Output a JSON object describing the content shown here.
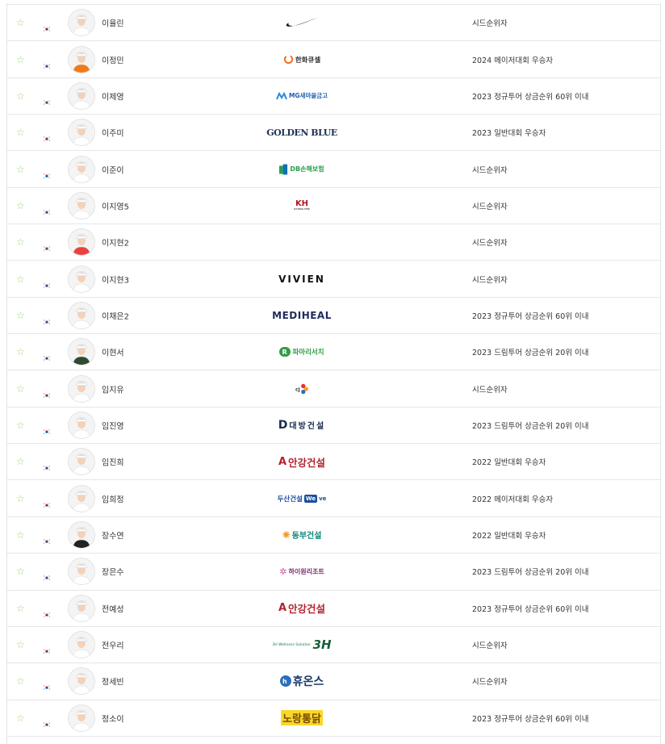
{
  "players": [
    {
      "name": "이율린",
      "sponsor_logo": "nike-logo",
      "sponsor": "",
      "qualification": "시드순위자",
      "shirt": "#ffffff"
    },
    {
      "name": "이정민",
      "sponsor_logo": "hanwha-life-logo",
      "sponsor": "한화큐셀",
      "qualification": "2024 메이저대회 우승자",
      "shirt": "#f07a1a"
    },
    {
      "name": "이제영",
      "sponsor_logo": "mg-saemaul-logo",
      "sponsor": "MG새마을금고",
      "qualification": "2023 정규투어 상금순위 60위 이내",
      "shirt": "#ffffff"
    },
    {
      "name": "이주미",
      "sponsor_logo": "golden-blue-logo",
      "sponsor": "GOLDEN BLUE",
      "qualification": "2023 일반대회 우승자",
      "shirt": "#ffffff"
    },
    {
      "name": "이준이",
      "sponsor_logo": "db-insurance-logo",
      "sponsor": "DB손해보험",
      "qualification": "시드순위자",
      "shirt": "#ffffff"
    },
    {
      "name": "이지영5",
      "sponsor_logo": "kyung-hee-logo",
      "sponsor": "KH",
      "qualification": "시드순위자",
      "shirt": "#ffffff"
    },
    {
      "name": "이지현2",
      "sponsor_logo": "",
      "sponsor": "",
      "qualification": "시드순위자",
      "shirt": "#e8433f"
    },
    {
      "name": "이지현3",
      "sponsor_logo": "vivien-logo",
      "sponsor": "VIVIEN",
      "qualification": "시드순위자",
      "shirt": "#ffffff"
    },
    {
      "name": "이채은2",
      "sponsor_logo": "mediheal-logo",
      "sponsor": "MEDIHEAL",
      "qualification": "2023 정규투어 상금순위 60위 이내",
      "shirt": "#ffffff"
    },
    {
      "name": "이현서",
      "sponsor_logo": "pamarisearch-logo",
      "sponsor": "파마리서치",
      "qualification": "2023 드림투어 상금순위 20위 이내",
      "shirt": "#2e4a33"
    },
    {
      "name": "임지유",
      "sponsor_logo": "cj-logo",
      "sponsor": "",
      "qualification": "시드순위자",
      "shirt": "#ffffff"
    },
    {
      "name": "임진영",
      "sponsor_logo": "daebang-logo",
      "sponsor": "대방건설",
      "qualification": "2023 드림투어 상금순위 20위 이내",
      "shirt": "#ffffff"
    },
    {
      "name": "임진희",
      "sponsor_logo": "ahn-gang-logo",
      "sponsor": "안강건설",
      "qualification": "2022 일반대회 우승자",
      "shirt": "#ffffff"
    },
    {
      "name": "임희정",
      "sponsor_logo": "doosan-we-logo",
      "sponsor": "두산건설",
      "qualification": "2022 메이저대회 우승자",
      "shirt": "#ffffff"
    },
    {
      "name": "장수연",
      "sponsor_logo": "dongbu-logo",
      "sponsor": "동부건설",
      "qualification": "2022 일반대회 우승자",
      "shirt": "#222222"
    },
    {
      "name": "장은수",
      "sponsor_logo": "high1-logo",
      "sponsor": "하이원리조트",
      "qualification": "2023 드림투어 상금순위 20위 이내",
      "shirt": "#ffffff"
    },
    {
      "name": "전예성",
      "sponsor_logo": "ahn-gang-logo",
      "sponsor": "안강건설",
      "qualification": "2023 정규투어 상금순위 60위 이내",
      "shirt": "#ffffff"
    },
    {
      "name": "전우리",
      "sponsor_logo": "3h-logo",
      "sponsor": "3H Wellness Solution",
      "qualification": "시드순위자",
      "shirt": "#ffffff"
    },
    {
      "name": "정세빈",
      "sponsor_logo": "huons-logo",
      "sponsor": "휴온스",
      "qualification": "시드순위자",
      "shirt": "#ffffff"
    },
    {
      "name": "정소이",
      "sponsor_logo": "nongshim-logo",
      "sponsor": "노랑통닭",
      "qualification": "2023 정규투어 상금순위 60위 이내",
      "shirt": "#ffffff"
    }
  ],
  "colors": {
    "star": "#9bd873",
    "divider": "#e6e6e6",
    "text": "#333333"
  }
}
